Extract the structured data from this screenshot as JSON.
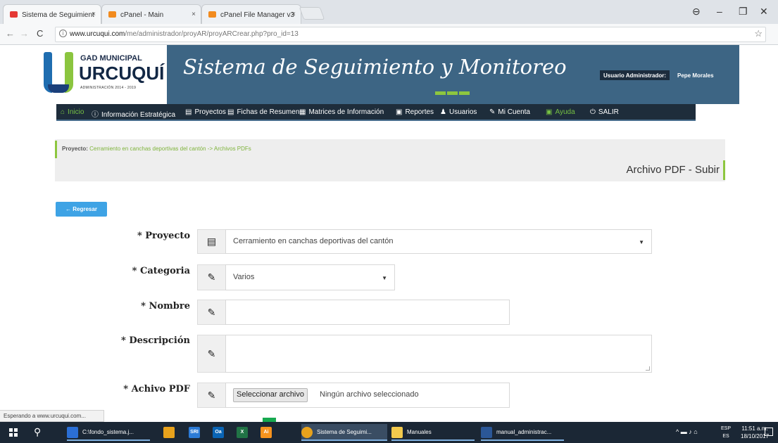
{
  "browser": {
    "tabs": [
      {
        "label": "Sistema de Seguimient",
        "close": "×",
        "color": "#e53935"
      },
      {
        "label": "cPanel - Main",
        "close": "×",
        "color": "#f28b1e"
      },
      {
        "label": "cPanel File Manager v3",
        "close": "×",
        "color": "#f28b1e"
      }
    ],
    "url_host": "www.urcuqui.com",
    "url_path": "/me/administrador/proyAR/proyARCrear.php?pro_id=13",
    "window_controls": {
      "user": "⊖",
      "minimize": "–",
      "maximize": "❐",
      "close": "✕"
    }
  },
  "site": {
    "logo_line1": "GAD MUNICIPAL",
    "logo_line2": "URCUQUÍ",
    "logo_line3": "ADMINISTRACIÓN 2014 - 2019",
    "title": "Sistema de Seguimiento y Monitoreo",
    "user_label": "Usuario Administrador:",
    "user_name": "Pepe Morales"
  },
  "menu": [
    {
      "icon": "⌂",
      "label": "Inicio",
      "green": true
    },
    {
      "icon": "ⓘ",
      "label": "Información Estratégica",
      "green": false
    },
    {
      "icon": "▤",
      "label": "Proyectos",
      "green": false
    },
    {
      "icon": "▤",
      "label": "Fichas de Resumen",
      "green": false
    },
    {
      "icon": "▦",
      "label": "Matrices de Información",
      "green": false
    },
    {
      "icon": "▣",
      "label": "Reportes",
      "green": false
    },
    {
      "icon": "♟",
      "label": "Usuarios",
      "green": false
    },
    {
      "icon": "✎",
      "label": "Mi Cuenta",
      "green": false
    },
    {
      "icon": "▣",
      "label": "Ayuda",
      "green": true
    },
    {
      "icon": "⏻",
      "label": "SALIR",
      "green": false
    }
  ],
  "breadcrumb": {
    "label": "Proyecto:",
    "value": "Cerramiento en canchas deportivas del cantón -> Archivos PDFs"
  },
  "page_title": "Archivo PDF - Subir",
  "back_button": "← Regresar",
  "form": {
    "proyecto": {
      "label": "* Proyecto",
      "icon": "▤",
      "value": "Cerramiento en canchas deportivas del cantón"
    },
    "categoria": {
      "label": "* Categoria",
      "icon": "✎",
      "value": "Varios"
    },
    "nombre": {
      "label": "* Nombre",
      "icon": "✎",
      "value": ""
    },
    "descripcion": {
      "label": "* Descripción",
      "icon": "✎",
      "value": ""
    },
    "archivo": {
      "label": "* Achivo PDF",
      "icon": "✎",
      "button": "Seleccionar archivo",
      "status": "Ningún archivo seleccionado"
    }
  },
  "status_bar": "Esperando a www.urcuqui.com...",
  "taskbar": {
    "apps": [
      {
        "label": "C:\\fondo_sistema.j...",
        "color": "#2b6fd6",
        "badge": "Ps"
      },
      {
        "label": "Sistema de Seguimi...",
        "color": "#e8a21c",
        "badge": ""
      },
      {
        "label": "Manuales",
        "color": "#f2c94c",
        "badge": ""
      },
      {
        "label": "manual_administrac...",
        "color": "#2b5797",
        "badge": "W"
      }
    ],
    "pinned": [
      {
        "badge": "",
        "color": "#e8a21c"
      },
      {
        "badge": "SRI",
        "color": "#2c7bd6"
      },
      {
        "badge": "Oa",
        "color": "#0a64b4"
      },
      {
        "badge": "X",
        "color": "#217346"
      },
      {
        "badge": "Ai",
        "color": "#f7931e"
      }
    ],
    "lang_line1": "ESP",
    "lang_line2": "ES",
    "time": "11:51 a.m.",
    "date": "18/10/2017",
    "tray_icons": "^ ▬ ♪ ⌂"
  }
}
